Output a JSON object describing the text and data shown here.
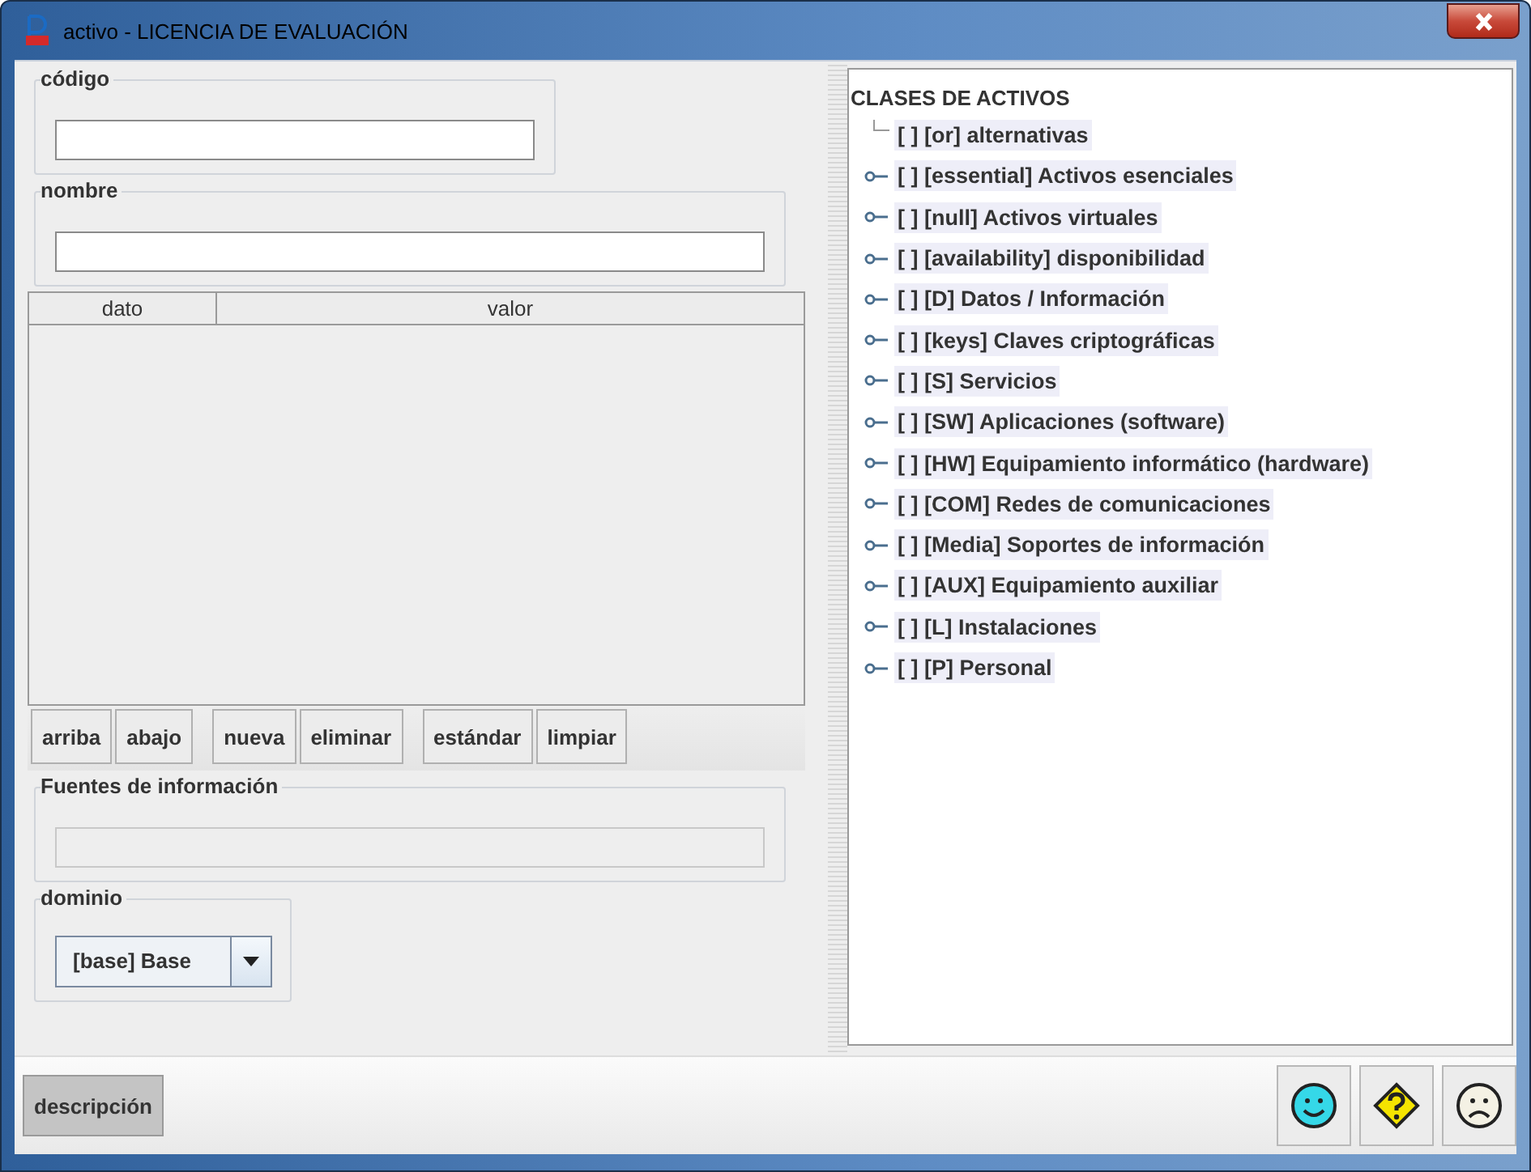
{
  "window": {
    "title": "activo - LICENCIA DE EVALUACIÓN"
  },
  "fields": [
    {
      "label": "código",
      "disabled": false,
      "wide": false
    },
    {
      "label": "nombre",
      "disabled": false,
      "wide": true
    }
  ],
  "table": {
    "columns": [
      "dato",
      "valor"
    ]
  },
  "button_groups": [
    [
      "arriba",
      "abajo"
    ],
    [
      "nueva",
      "eliminar"
    ],
    [
      "estándar",
      "limpiar"
    ]
  ],
  "sources": {
    "label": "Fuentes de información",
    "disabled": true
  },
  "domain": {
    "label": "dominio",
    "value": "[base] Base"
  },
  "tree": {
    "root": "CLASES DE ACTIVOS",
    "items": [
      {
        "label": "[ ] [or] alternativas",
        "kind": "leaf"
      },
      {
        "label": "[ ] [essential] Activos esenciales",
        "kind": "node"
      },
      {
        "label": "[ ] [null] Activos virtuales",
        "kind": "node"
      },
      {
        "label": "[ ] [availability] disponibilidad",
        "kind": "node"
      },
      {
        "label": "[ ] [D] Datos / Información",
        "kind": "node"
      },
      {
        "label": "[ ] [keys] Claves criptográficas",
        "kind": "node"
      },
      {
        "label": "[ ] [S] Servicios",
        "kind": "node"
      },
      {
        "label": "[ ] [SW] Aplicaciones (software)",
        "kind": "node"
      },
      {
        "label": "[ ] [HW] Equipamiento informático (hardware)",
        "kind": "node"
      },
      {
        "label": "[ ] [COM] Redes de comunicaciones",
        "kind": "node"
      },
      {
        "label": "[ ] [Media] Soportes de información",
        "kind": "node"
      },
      {
        "label": "[ ] [AUX] Equipamiento auxiliar",
        "kind": "node"
      },
      {
        "label": "[ ] [L] Instalaciones",
        "kind": "node"
      },
      {
        "label": "[ ] [P] Personal",
        "kind": "node"
      }
    ]
  },
  "description_button": {
    "label": "descripción",
    "pressed": true
  },
  "status_buttons": [
    {
      "kind": "happy"
    },
    {
      "kind": "question"
    },
    {
      "kind": "sad"
    }
  ]
}
